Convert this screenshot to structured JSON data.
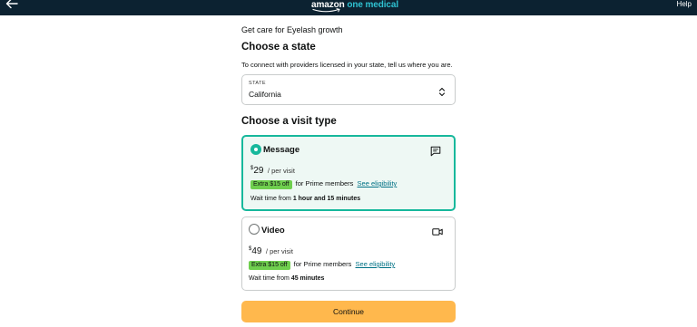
{
  "header": {
    "logo_part1": "amazon",
    "logo_part2": "one medical",
    "help_label": "Help",
    "back_icon": "arrow-left-icon"
  },
  "page": {
    "kicker": "Get care for Eyelash growth",
    "state_heading": "Choose a state",
    "state_description": "To connect with providers licensed in your state, tell us where you are.",
    "visit_heading": "Choose a visit type",
    "continue_label": "Continue"
  },
  "state_select": {
    "label": "STATE",
    "value": "California"
  },
  "visit_options": [
    {
      "title": "Message",
      "selected": true,
      "icon": "chat-bubble-icon",
      "currency": "$",
      "price": "29",
      "price_unit": "/ per visit",
      "badge": "Extra $15 off",
      "prime_text": "for Prime members",
      "eligibility_link": "See eligibility",
      "wait_prefix": "Wait time from",
      "wait_value": "1 hour and 15 minutes"
    },
    {
      "title": "Video",
      "selected": false,
      "icon": "video-camera-icon",
      "currency": "$",
      "price": "49",
      "price_unit": "/ per visit",
      "badge": "Extra $15 off",
      "prime_text": "for Prime members",
      "eligibility_link": "See eligibility",
      "wait_prefix": "Wait time from",
      "wait_value": "45 minutes"
    }
  ],
  "colors": {
    "header_bg": "#0c2231",
    "logo_accent": "#2fc2d2",
    "selected_border": "#17b89c",
    "selected_bg": "#eef8f4",
    "badge_bg": "#6fcf4e",
    "link": "#007185",
    "button_bg": "#ffb84d"
  }
}
